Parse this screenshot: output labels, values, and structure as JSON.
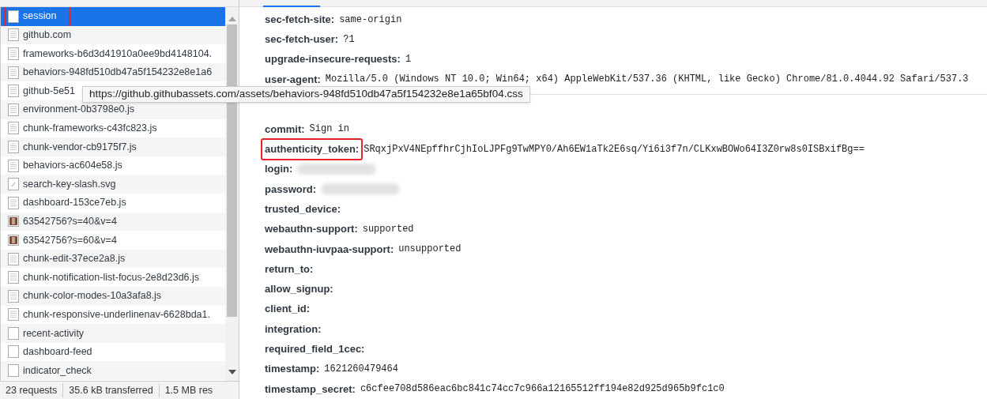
{
  "requests": [
    {
      "name": "session",
      "kind": "blank",
      "selected": true,
      "highlighted": true
    },
    {
      "name": "github.com",
      "kind": "doc",
      "selected": false,
      "highlighted": false
    },
    {
      "name": "frameworks-b6d3d41910a0ee9bd4148104.",
      "kind": "doc",
      "selected": false,
      "highlighted": false
    },
    {
      "name": "behaviors-948fd510db47a5f154232e8e1a6",
      "kind": "doc",
      "selected": false,
      "highlighted": false
    },
    {
      "name": "github-5e51",
      "kind": "doc",
      "selected": false,
      "highlighted": false
    },
    {
      "name": "environment-0b3798e0.js",
      "kind": "doc",
      "selected": false,
      "highlighted": false
    },
    {
      "name": "chunk-frameworks-c43fc823.js",
      "kind": "doc",
      "selected": false,
      "highlighted": false
    },
    {
      "name": "chunk-vendor-cb9175f7.js",
      "kind": "doc",
      "selected": false,
      "highlighted": false
    },
    {
      "name": "behaviors-ac604e58.js",
      "kind": "doc",
      "selected": false,
      "highlighted": false
    },
    {
      "name": "search-key-slash.svg",
      "kind": "svg",
      "selected": false,
      "highlighted": false
    },
    {
      "name": "dashboard-153ce7eb.js",
      "kind": "doc",
      "selected": false,
      "highlighted": false
    },
    {
      "name": "63542756?s=40&v=4",
      "kind": "image",
      "selected": false,
      "highlighted": false
    },
    {
      "name": "63542756?s=60&v=4",
      "kind": "image",
      "selected": false,
      "highlighted": false
    },
    {
      "name": "chunk-edit-37ece2a8.js",
      "kind": "doc",
      "selected": false,
      "highlighted": false
    },
    {
      "name": "chunk-notification-list-focus-2e8d23d6.js",
      "kind": "doc",
      "selected": false,
      "highlighted": false
    },
    {
      "name": "chunk-color-modes-10a3afa8.js",
      "kind": "doc",
      "selected": false,
      "highlighted": false
    },
    {
      "name": "chunk-responsive-underlinenav-6628bda1.",
      "kind": "doc",
      "selected": false,
      "highlighted": false
    },
    {
      "name": "recent-activity",
      "kind": "blank",
      "selected": false,
      "highlighted": false
    },
    {
      "name": "dashboard-feed",
      "kind": "blank",
      "selected": false,
      "highlighted": false
    },
    {
      "name": "indicator_check",
      "kind": "blank",
      "selected": false,
      "highlighted": false
    }
  ],
  "tooltip": "https://github.githubassets.com/assets/behaviors-948fd510db47a5f154232e8e1a65bf04.css",
  "status_bar": [
    "23 requests",
    "35.6 kB transferred",
    "1.5 MB res"
  ],
  "headers": [
    {
      "key": "sec-fetch-site:",
      "value": "same-origin"
    },
    {
      "key": "sec-fetch-user:",
      "value": "?1"
    },
    {
      "key": "upgrade-insecure-requests:",
      "value": "1"
    },
    {
      "key": "user-agent:",
      "value": "Mozilla/5.0 (Windows NT 10.0; Win64; x64) AppleWebKit/537.36 (KHTML, like Gecko) Chrome/81.0.4044.92 Safari/537.3"
    }
  ],
  "form_data": [
    {
      "key": "commit:",
      "value": "Sign in",
      "highlighted": false,
      "redacted": false
    },
    {
      "key": "authenticity_token:",
      "value": "SRqxjPxV4NEpffhrCjhIoLJPFg9TwMPY0/Ah6EW1aTk2E6sq/Yi6i3f7n/CLKxwBOWo64I3Z0rw8s0ISBxifBg==",
      "highlighted": true,
      "redacted": false
    },
    {
      "key": "login:",
      "highlighted": false,
      "redacted": true
    },
    {
      "key": "password:",
      "highlighted": false,
      "redacted": true
    },
    {
      "key": "trusted_device:",
      "highlighted": false,
      "redacted": false
    },
    {
      "key": "webauthn-support:",
      "value": "supported",
      "highlighted": false,
      "redacted": false
    },
    {
      "key": "webauthn-iuvpaa-support:",
      "value": "unsupported",
      "highlighted": false,
      "redacted": false
    },
    {
      "key": "return_to:",
      "highlighted": false,
      "redacted": false
    },
    {
      "key": "allow_signup:",
      "highlighted": false,
      "redacted": false
    },
    {
      "key": "client_id:",
      "highlighted": false,
      "redacted": false
    },
    {
      "key": "integration:",
      "highlighted": false,
      "redacted": false
    },
    {
      "key": "required_field_1cec:",
      "highlighted": false,
      "redacted": false
    },
    {
      "key": "timestamp:",
      "value": "1621260479464",
      "highlighted": false,
      "redacted": false
    },
    {
      "key": "timestamp_secret:",
      "value": "c6cfee708d586eac6bc841c74cc7c966a12165512ff194e82d925d965b9fc1c0",
      "highlighted": false,
      "redacted": false
    }
  ]
}
